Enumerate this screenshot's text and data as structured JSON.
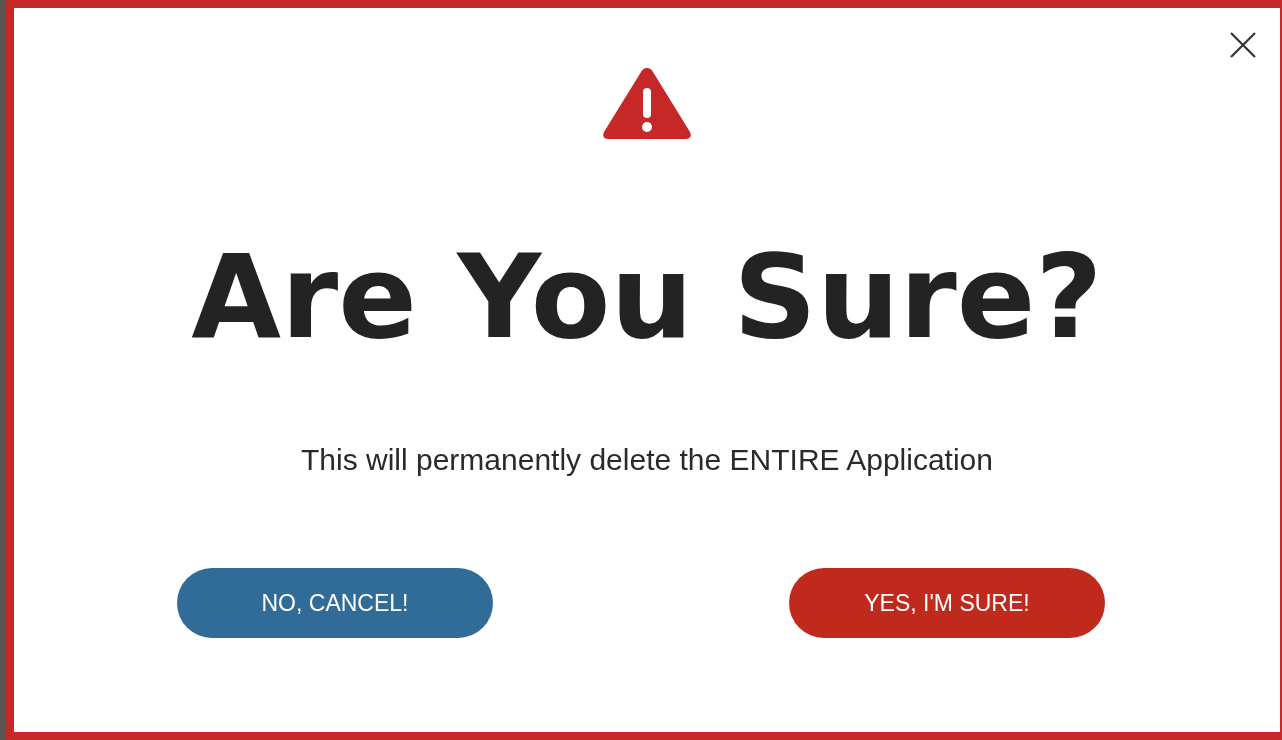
{
  "dialog": {
    "title": "Are You Sure?",
    "message": "This will permanently delete the ENTIRE Application",
    "buttons": [
      {
        "label": "NO, CANCEL!",
        "kind": "cancel"
      },
      {
        "label": "YES, I'M SURE!",
        "kind": "confirm"
      }
    ]
  }
}
